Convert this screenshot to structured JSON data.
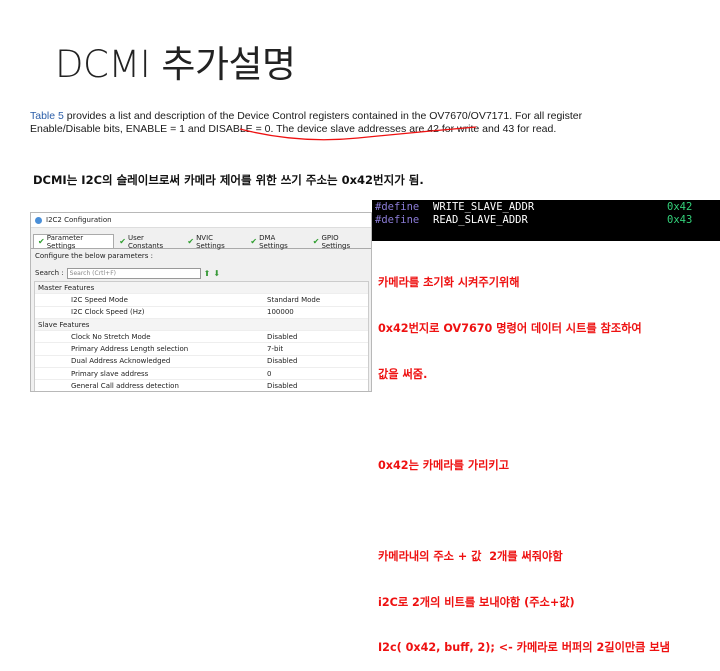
{
  "slide": {
    "title": "DCMI 추가설명"
  },
  "doc": {
    "link": "Table 5",
    "line1_rest": " provides a list and description of the Device Control registers contained in the OV7670/OV7171. For all register",
    "line2": "Enable/Disable bits, ENABLE = 1 and DISABLE = 0. The device slave addresses are 42 for write and 43 for read."
  },
  "note": "DCMI는 I2C의 슬레이브로써 카메라 제어를 위한 쓰기 주소는 0x42번지가 됨.",
  "panel": {
    "title": "I2C2 Configuration",
    "tabs": [
      {
        "label": "Parameter Settings"
      },
      {
        "label": "User Constants"
      },
      {
        "label": "NVIC Settings"
      },
      {
        "label": "DMA Settings"
      },
      {
        "label": "GPIO Settings"
      }
    ],
    "configure_text": "Configure the below parameters :",
    "search_label": "Search :",
    "search_placeholder": "Search (Crtl+F)",
    "rows": [
      {
        "type": "section",
        "name": "Master Features",
        "value": ""
      },
      {
        "type": "param",
        "name": "I2C Speed Mode",
        "value": "Standard Mode"
      },
      {
        "type": "param",
        "name": "I2C Clock Speed (Hz)",
        "value": "100000"
      },
      {
        "type": "section",
        "name": "Slave Features",
        "value": ""
      },
      {
        "type": "param",
        "name": "Clock No Stretch Mode",
        "value": "Disabled"
      },
      {
        "type": "param",
        "name": "Primary Address Length selection",
        "value": "7-bit"
      },
      {
        "type": "param",
        "name": "Dual Address Acknowledged",
        "value": "Disabled"
      },
      {
        "type": "param",
        "name": "Primary slave address",
        "value": "0"
      },
      {
        "type": "param",
        "name": "General Call address detection",
        "value": "Disabled"
      }
    ]
  },
  "code": [
    {
      "kw": "#define",
      "name": "WRITE_SLAVE_ADDR",
      "value": "0x42"
    },
    {
      "kw": "#define",
      "name": "READ_SLAVE_ADDR",
      "value": "0x43"
    }
  ],
  "red_notes": [
    "카메라를 초기화 시켜주기위해",
    "0x42번지로 OV7670 명령어 데이터 시트를 참조하여",
    "값을 써줌.",
    "",
    "0x42는 카메라를 가리키고",
    "",
    "카메라내의 주소 + 값  2개를 써줘야함",
    "i2C로 2개의 비트를 보내야함 (주소+값)",
    "I2c( 0x42, buff, 2); <- 카메라로 버퍼의 2길이만큼 보냄"
  ],
  "colors": {
    "red": "#ee1111",
    "link": "#2b5ea8",
    "code_green": "#33d17a",
    "code_keyword": "#8a7bd6"
  }
}
